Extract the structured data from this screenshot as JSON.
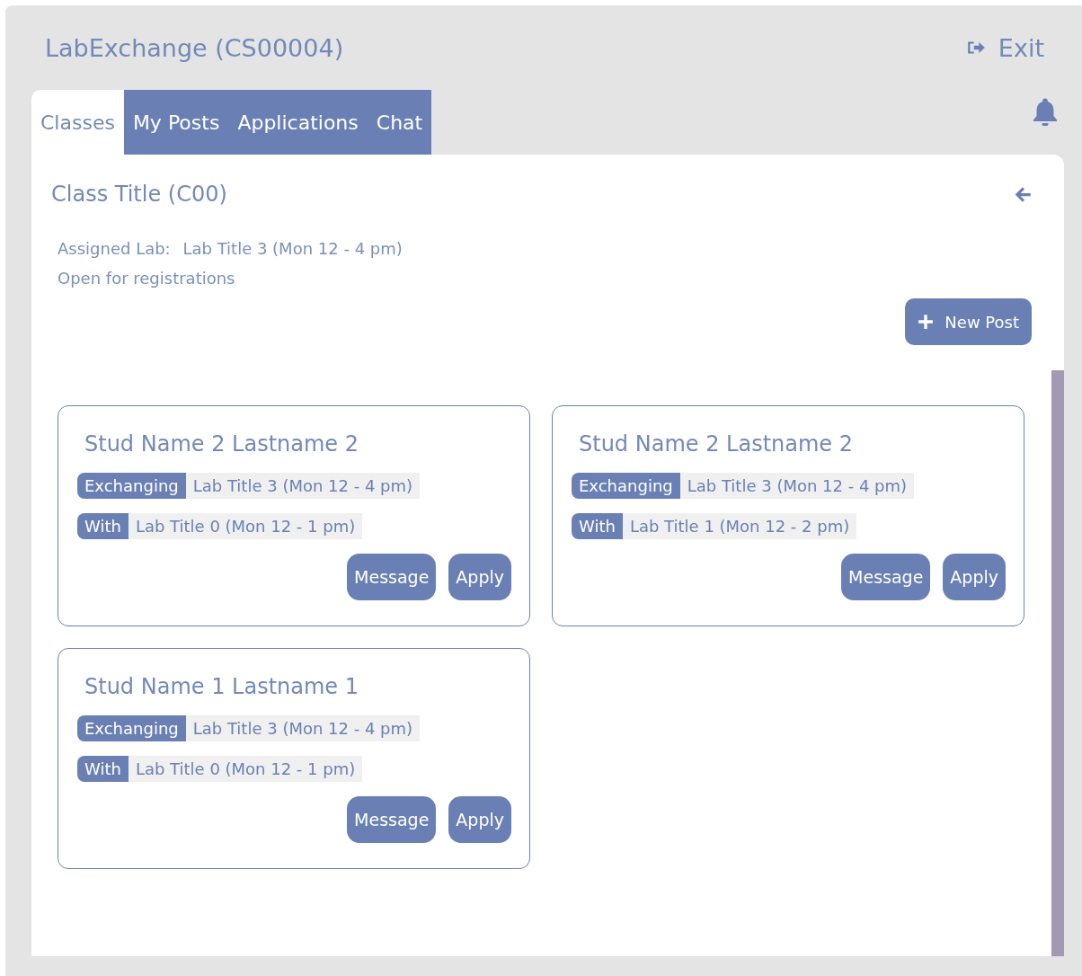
{
  "header": {
    "title": "LabExchange (CS00004)",
    "exit_label": "Exit"
  },
  "tabs": [
    {
      "label": "Classes",
      "selected": true
    },
    {
      "label": "My Posts",
      "selected": false
    },
    {
      "label": "Applications",
      "selected": false
    },
    {
      "label": "Chat",
      "selected": false
    }
  ],
  "class_panel": {
    "title": "Class Title (C00)",
    "assigned_lab_label": "Assigned Lab:",
    "assigned_lab": "Lab Title 3 (Mon 12 - 4 pm)",
    "status": "Open for registrations",
    "new_post_label": "New Post"
  },
  "posts": [
    {
      "student": "Stud Name 2 Lastname 2",
      "exchanging_label": "Exchanging",
      "exchanging": "Lab Title 3 (Mon 12 - 4 pm)",
      "with_label": "With",
      "with": "Lab Title 0 (Mon 12 - 1 pm)",
      "actions": [
        "Message",
        "Apply"
      ]
    },
    {
      "student": "Stud Name 2 Lastname 2",
      "exchanging_label": "Exchanging",
      "exchanging": "Lab Title 3 (Mon 12 - 4 pm)",
      "with_label": "With",
      "with": "Lab Title 1 (Mon 12 - 2 pm)",
      "actions": [
        "Message",
        "Apply"
      ]
    },
    {
      "student": "Stud Name 1 Lastname 1",
      "exchanging_label": "Exchanging",
      "exchanging": "Lab Title 3 (Mon 12 - 4 pm)",
      "with_label": "With",
      "with": "Lab Title 0 (Mon 12 - 1 pm)",
      "actions": [
        "Message",
        "Apply"
      ]
    }
  ]
}
